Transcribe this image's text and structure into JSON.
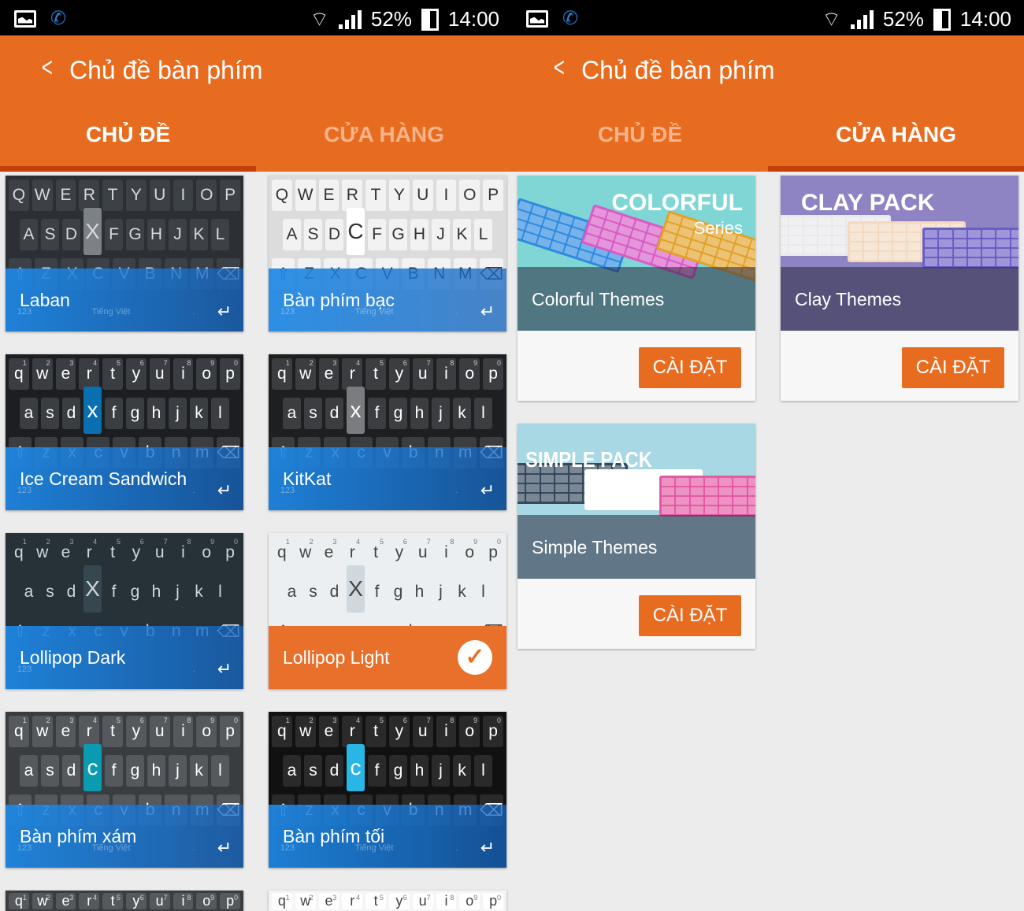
{
  "status": {
    "battery": "52%",
    "time": "14:00",
    "icons": [
      "image-icon",
      "phone-call-icon",
      "wifi-icon",
      "signal-icon",
      "battery-icon"
    ]
  },
  "header": {
    "title": "Chủ đề bàn phím",
    "back_icon": "chevron-left-icon"
  },
  "tabs": [
    {
      "label": "CHỦ ĐỀ"
    },
    {
      "label": "CỬA HÀNG"
    }
  ],
  "colors": {
    "primary": "#e86c20",
    "indicator": "#c3400c"
  },
  "themes": [
    {
      "name": "Laban",
      "case": "upper",
      "hl": "X",
      "bg": "#2c3035",
      "key": "#3c4148",
      "fg": "#d8d8d8",
      "hlbg": "#7b8187",
      "space": "Tiếng Việt",
      "num": "123"
    },
    {
      "name": "Bàn phím bạc",
      "case": "upper",
      "hl": "C",
      "bg": "#dcdcdc",
      "key": "#f2f2f2",
      "fg": "#333",
      "hlbg": "#ffffff",
      "space": "Tiếng Việt",
      "num": "123"
    },
    {
      "name": "Ice Cream Sandwich",
      "case": "lower",
      "hl": "x",
      "bg": "#1c1e21",
      "key": "#3a3d42",
      "fg": "#fff",
      "hlbg": "#0a6fb0",
      "space": "",
      "num": "123"
    },
    {
      "name": "KitKat",
      "case": "lower",
      "hl": "x",
      "bg": "#1e1f21",
      "key": "#3b3d40",
      "fg": "#fff",
      "hlbg": "#7a7c7f",
      "space": "",
      "num": "123"
    },
    {
      "name": "Lollipop Dark",
      "case": "lower",
      "hl": "X",
      "bg": "#263238",
      "key": "#263238",
      "fg": "#d0d6d9",
      "hlbg": "#37474f",
      "space": "",
      "num": "123"
    },
    {
      "name": "Lollipop Light",
      "case": "lower",
      "hl": "X",
      "bg": "#eceff1",
      "key": "#eceff1",
      "fg": "#444",
      "hlbg": "#cfd8dc",
      "space": "",
      "num": "",
      "selected": true
    },
    {
      "name": "Bàn phím xám",
      "case": "lower",
      "hl": "c",
      "bg": "#3a3d40",
      "key": "#55585c",
      "fg": "#fff",
      "hlbg": "#0a9bb0",
      "space": "Tiếng Việt",
      "num": "123"
    },
    {
      "name": "Bàn phím tối",
      "case": "lower",
      "hl": "c",
      "bg": "#111",
      "key": "#2a2a2a",
      "fg": "#fff",
      "hlbg": "#29b6e6",
      "space": "Tiếng Việt",
      "num": "123"
    },
    {
      "name": "",
      "case": "lower",
      "hl": "",
      "bg": "#3a3d40",
      "key": "#55585c",
      "fg": "#fff",
      "hlbg": "#55585c",
      "space": "",
      "num": ""
    },
    {
      "name": "",
      "case": "lower",
      "hl": "",
      "bg": "#f5f5f5",
      "key": "#fff",
      "fg": "#444",
      "hlbg": "#fff",
      "space": "",
      "num": ""
    }
  ],
  "keyrows": [
    "qwertyuiop",
    "asdcfghjkl",
    "zxcvbnm"
  ],
  "store": [
    {
      "brand": "COLORFUL",
      "sub": "Series",
      "name": "Colorful Themes",
      "button": "CÀI ĐẶT",
      "bg": "#7fd6d4"
    },
    {
      "brand": "CLAY PACK",
      "sub": "",
      "name": "Clay Themes",
      "button": "CÀI ĐẶT",
      "bg": "#8e84c4"
    },
    {
      "brand": "SIMPLE PACK",
      "sub": "",
      "name": "Simple Themes",
      "button": "CÀI ĐẶT",
      "bg": "#a7d8e3"
    }
  ]
}
